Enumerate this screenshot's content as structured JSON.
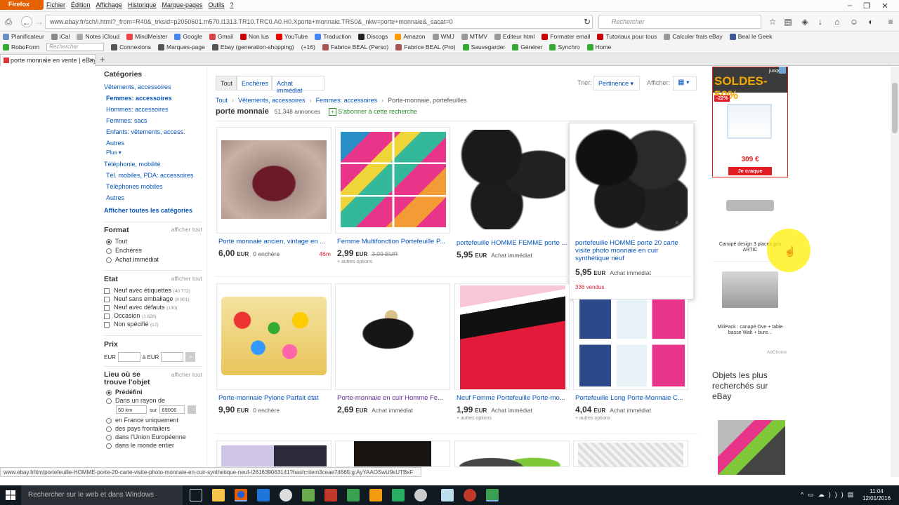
{
  "browser": {
    "app_button": "Firefox",
    "menu": [
      "Fichier",
      "Édition",
      "Affichage",
      "Historique",
      "Marque-pages",
      "Outils",
      "?"
    ],
    "url": "www.ebay.fr/sch/i.html?_from=R40&_trksid=p2050601.m570.l1313.TR10.TRC0.A0.H0.Xporte+monnaie.TRS0&_nkw=porte+monnaie&_sacat=0",
    "search_placeholder": "Rechercher",
    "bookmarks1": [
      "Planificateur",
      "iCal",
      "Notes iCloud",
      "MindMeister",
      "Google",
      "Gmail",
      "Non lus",
      "YouTube",
      "Traduction",
      "Discogs",
      "Amazon",
      "WMJ",
      "MTMV",
      "Editeur html",
      "Formater email",
      "Tutoriaux pour tous",
      "Calculer frais eBay",
      "Beal le Geek"
    ],
    "roboform": "RoboForm",
    "roboform_placeholder": "Rechercher",
    "bookmarks2": [
      "Connexions",
      "Marques-page",
      "Ebay (generation-shopping)",
      "(+16)",
      "Fabrice BEAL (Perso)",
      "Fabrice BEAL (Pro)",
      "Sauvegarder",
      "Générer",
      "Synchro",
      "Home"
    ],
    "tab_title": "porte monnaie en vente | eBay",
    "status_url": "www.ebay.fr/itm/portefeuille-HOMME-porte-20-carte-visite-photo-monnaie-en-cuir-synthetique-neuf-/261639063141?hash=item3ceae74665:g:AyYAAOSwU9xUTBxF"
  },
  "sidebar": {
    "categories_title": "Catégories",
    "categories": [
      "Vêtements, accessoires",
      "Femmes: accessoires",
      "Hommes: accessoires",
      "Femmes: sacs",
      "Enfants: vêtements, access.",
      "Autres",
      "Plus",
      "Téléphonie, mobilité",
      "Tél. mobiles, PDA: accessoires",
      "Téléphones mobiles",
      "Autres",
      "Afficher toutes les catégories"
    ],
    "format_title": "Format",
    "show_all": "afficher tout",
    "formats": [
      "Tout",
      "Enchères",
      "Achat immédiat"
    ],
    "etat_title": "Etat",
    "etats": [
      {
        "label": "Neuf avec étiquettes",
        "count": "(40 772)"
      },
      {
        "label": "Neuf sans emballage",
        "count": "(8 801)"
      },
      {
        "label": "Neuf avec défauts",
        "count": "(130)"
      },
      {
        "label": "Occasion",
        "count": "(1 628)"
      },
      {
        "label": "Non spécifié",
        "count": "(17)"
      }
    ],
    "prix_title": "Prix",
    "eur": "EUR",
    "a_eur": "à EUR",
    "lieu_title": "Lieu où se trouve l'objet",
    "lieu_options": [
      "Prédéfini",
      "Dans un rayon de",
      "en France uniquement",
      "des pays frontaliers",
      "dans l'Union Européenne",
      "dans le monde entier"
    ],
    "rayon": "50 km",
    "sur": "sur",
    "postcode": "69006"
  },
  "main": {
    "filters": [
      "Tout",
      "Enchères",
      "Achat immédiat"
    ],
    "sort_label": "Trier:",
    "sort_value": "Pertinence",
    "view_label": "Afficher:",
    "breadcrumb": [
      "Tout",
      "Vêtements, accessoires",
      "Femmes: accessoires",
      "Porte-monnaie, portefeuilles"
    ],
    "query": "porte monnaie",
    "count": "51,348 annonces",
    "subscribe": "S'abonner à cette recherche",
    "items": [
      {
        "title": "Porte monnaie ancien, vintage en ...",
        "price": "6,00",
        "cur": "EUR",
        "meta": "0 enchère",
        "time": "46m",
        "old": "",
        "extra": ""
      },
      {
        "title": "Femme Multifonction Portefeuille P...",
        "price": "2,99",
        "cur": "EUR",
        "meta": "",
        "time": "",
        "old": "3,99 EUR",
        "extra": "+ autres options"
      },
      {
        "title": "portefeuille HOMME FEMME porte ...",
        "price": "5,95",
        "cur": "EUR",
        "meta": "Achat immédiat",
        "time": "",
        "old": "",
        "extra": ""
      },
      {
        "title": "portefeuille HOMME porte 20 carte visite photo monnaie en cuir synthétique neuf",
        "price": "5,95",
        "cur": "EUR",
        "meta": "Achat immédiat",
        "time": "",
        "old": "",
        "extra": "336 vendus"
      },
      {
        "title": "Porte-monnaie Pylone Parfait état",
        "price": "9,90",
        "cur": "EUR",
        "meta": "0 enchère",
        "time": "",
        "old": "",
        "extra": ""
      },
      {
        "title": "Porte-monnaie en cuir Homme Fe...",
        "price": "2,69",
        "cur": "EUR",
        "meta": "Achat immédiat",
        "time": "",
        "old": "",
        "extra": ""
      },
      {
        "title": "Neuf Femme Portefeuille Porte-mo...",
        "price": "1,99",
        "cur": "EUR",
        "meta": "Achat immédiat",
        "time": "",
        "old": "",
        "extra": "+ autres options"
      },
      {
        "title": "Portefeuille Long Porte-Monnaie C...",
        "price": "4,04",
        "cur": "EUR",
        "meta": "Achat immédiat",
        "time": "",
        "old": "",
        "extra": "+ autres options"
      }
    ]
  },
  "ads": {
    "soldes_top": "jusqu'à",
    "soldes": "SOLDES-50%",
    "discount": "-22%",
    "price": "309 €",
    "cta": "Je craque",
    "ad2": "Canapé design 3 places gris ARTIC",
    "ad3": "MiliPack : canapé Ove + table basse Walt + bure...",
    "adchoice": "AdChoice",
    "popular": "Objets les plus recherchés sur eBay"
  },
  "taskbar": {
    "search": "Rechercher sur le web et dans Windows",
    "time": "11:04",
    "date": "12/01/2016"
  },
  "colors": {
    "ebay_blue": "#0654ba",
    "firefox_orange": "#e66000",
    "ad_red": "#e31b23"
  }
}
